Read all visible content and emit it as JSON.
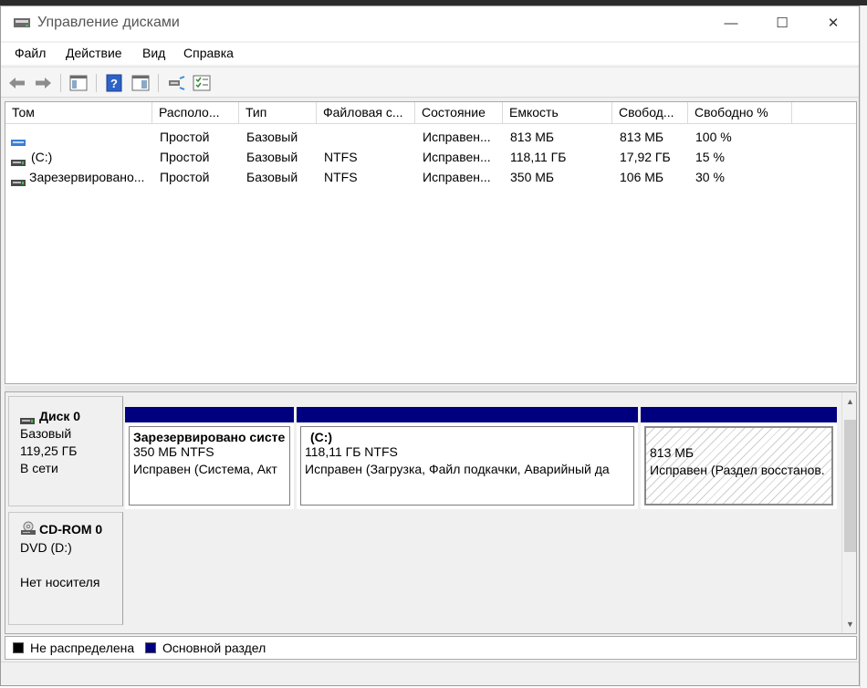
{
  "window": {
    "title": "Управление дисками",
    "controls": {
      "minimize": "—",
      "maximize": "☐",
      "close": "✕"
    }
  },
  "menu": [
    "Файл",
    "Действие",
    "Вид",
    "Справка"
  ],
  "toolbar": [
    "back-icon",
    "forward-icon",
    "console-tree-icon",
    "help-icon",
    "properties-icon",
    "connect-icon",
    "list-view-icon"
  ],
  "volume_list": {
    "columns": [
      "Том",
      "Располо...",
      "Тип",
      "Файловая с...",
      "Состояние",
      "Емкость",
      "Свобод...",
      "Свободно %"
    ],
    "rows": [
      {
        "name": "",
        "layout": "Простой",
        "type": "Базовый",
        "fs": "",
        "status": "Исправен...",
        "capacity": "813 МБ",
        "free": "813 МБ",
        "free_pct": "100 %"
      },
      {
        "name": "(C:)",
        "layout": "Простой",
        "type": "Базовый",
        "fs": "NTFS",
        "status": "Исправен...",
        "capacity": "118,11 ГБ",
        "free": "17,92 ГБ",
        "free_pct": "15 %"
      },
      {
        "name": "Зарезервировано...",
        "layout": "Простой",
        "type": "Базовый",
        "fs": "NTFS",
        "status": "Исправен...",
        "capacity": "350 МБ",
        "free": "106 МБ",
        "free_pct": "30 %"
      }
    ]
  },
  "disks": [
    {
      "name": "Диск 0",
      "type": "Базовый",
      "size": "119,25 ГБ",
      "state": "В сети",
      "partitions": [
        {
          "title": "Зарезервировано систе",
          "size": "350 МБ NTFS",
          "status": "Исправен (Система, Акт"
        },
        {
          "title": "(C:)",
          "size": "118,11 ГБ NTFS",
          "status": "Исправен (Загрузка, Файл подкачки, Аварийный да"
        },
        {
          "title": "",
          "size": "813 МБ",
          "status": "Исправен (Раздел восстанов."
        }
      ]
    },
    {
      "name": "CD-ROM 0",
      "type": "DVD (D:)",
      "state": "Нет носителя"
    }
  ],
  "legend": [
    {
      "label": "Не распределена",
      "color": "#000000"
    },
    {
      "label": "Основной раздел",
      "color": "#00007e"
    }
  ]
}
